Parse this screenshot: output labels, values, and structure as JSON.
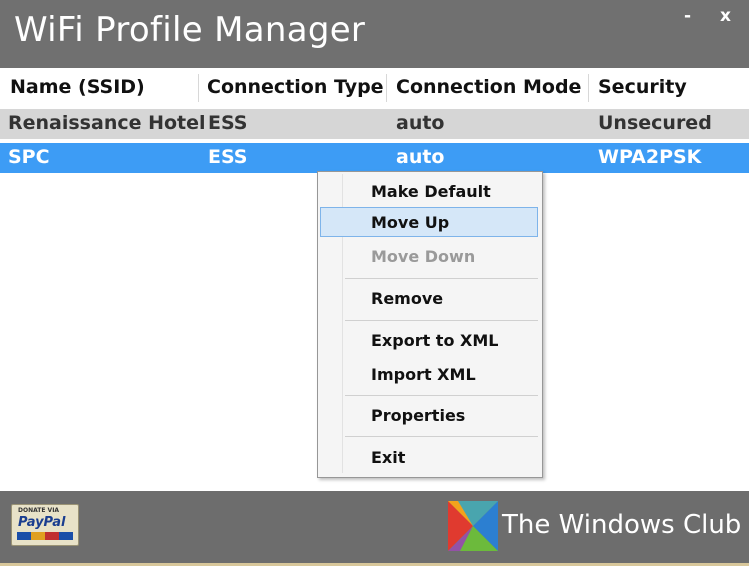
{
  "window": {
    "title": "WiFi Profile Manager",
    "minimize_label": "-",
    "close_label": "x"
  },
  "table": {
    "columns": [
      "Name (SSID)",
      "Connection Type",
      "Connection Mode",
      "Security"
    ],
    "rows": [
      {
        "name": "Renaissance Hotel",
        "type": "ESS",
        "mode": "auto",
        "security": "Unsecured"
      },
      {
        "name": "SPC",
        "type": "ESS",
        "mode": "auto",
        "security": "WPA2PSK"
      }
    ],
    "selected_row": 1
  },
  "context_menu": {
    "items": [
      {
        "label": "Make Default",
        "enabled": true
      },
      {
        "label": "Move Up",
        "enabled": true,
        "highlighted": true
      },
      {
        "label": "Move Down",
        "enabled": false
      },
      {
        "label": "Remove",
        "enabled": true
      },
      {
        "label": "Export to XML",
        "enabled": true
      },
      {
        "label": "Import XML",
        "enabled": true
      },
      {
        "label": "Properties",
        "enabled": true
      },
      {
        "label": "Exit",
        "enabled": true
      }
    ]
  },
  "footer": {
    "donate_badge": {
      "line1": "DONATE VIA",
      "brand": "PayPal"
    },
    "brand_text": "The Windows Club"
  },
  "colors": {
    "titlebar": "#707070",
    "selected_row": "#3d9cf5",
    "alt_row": "#d6d6d6",
    "footer": "#6d6d6d"
  }
}
